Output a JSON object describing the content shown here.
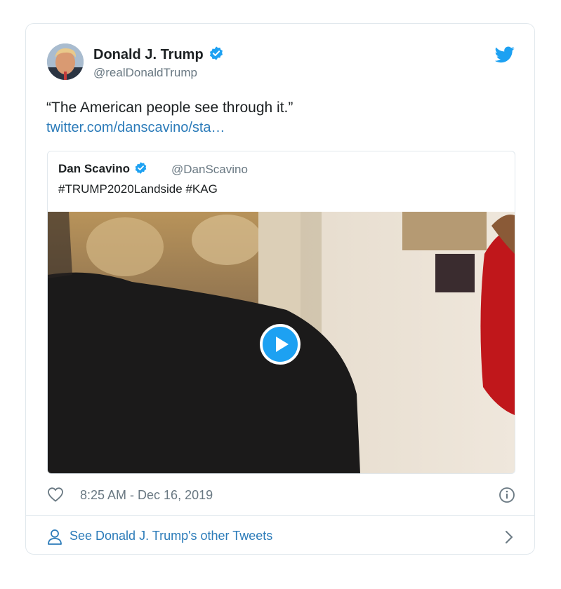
{
  "author": {
    "name": "Donald J. Trump",
    "handle": "@realDonaldTrump"
  },
  "tweet": {
    "text": "“The American people see through it.”",
    "link": "twitter.com/danscavino/sta…"
  },
  "quoted": {
    "name": "Dan Scavino",
    "handle": "@DanScavino",
    "text": "#TRUMP2020Landside #KAG"
  },
  "meta": {
    "timestamp": "8:25 AM - Dec 16, 2019"
  },
  "footer": {
    "more_label": "See Donald J. Trump's other Tweets"
  },
  "colors": {
    "link": "#2b7bb9",
    "verified": "#1da1f2",
    "muted": "#697882",
    "border": "#e1e8ed"
  },
  "icons": [
    "verified-badge-icon",
    "twitter-bird-icon",
    "play-icon",
    "heart-icon",
    "info-icon",
    "person-icon",
    "chevron-right-icon"
  ]
}
